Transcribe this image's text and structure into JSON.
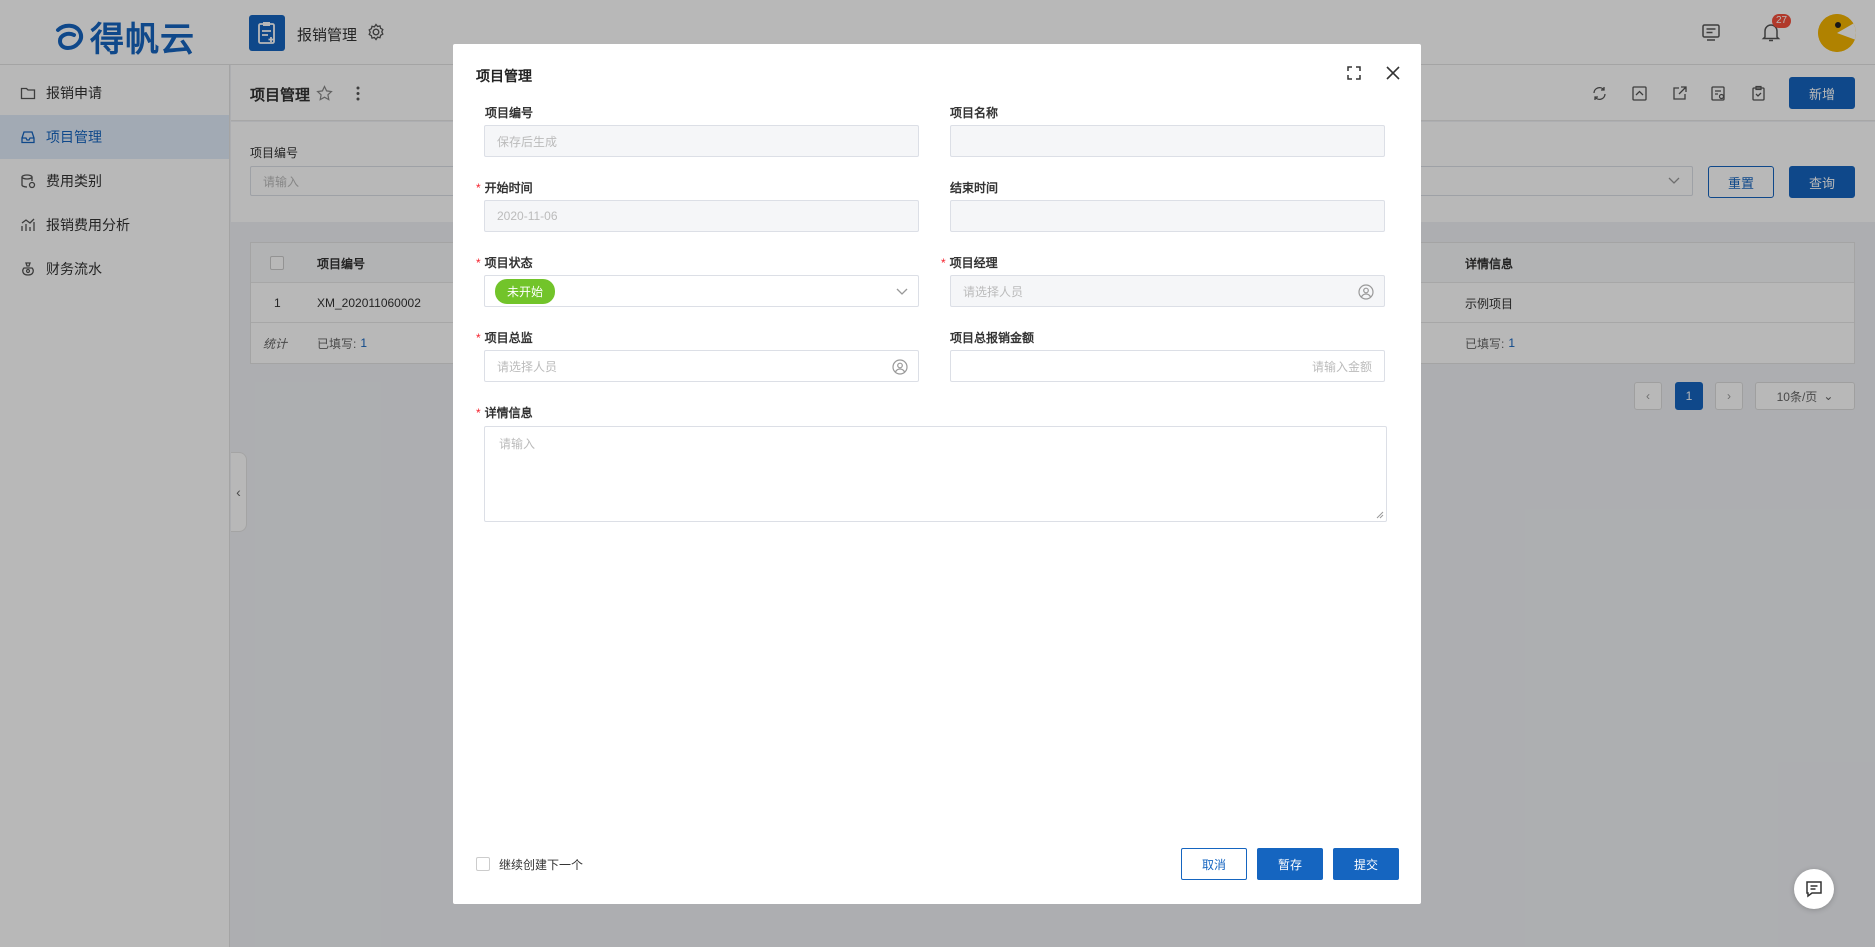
{
  "app": {
    "logo": "得帆云",
    "module_title": "报销管理"
  },
  "header": {
    "notification_count": "27"
  },
  "sidebar": {
    "items": [
      {
        "label": "报销申请",
        "icon": "folder-icon"
      },
      {
        "label": "项目管理",
        "icon": "inbox-icon",
        "active": true
      },
      {
        "label": "费用类别",
        "icon": "database-icon"
      },
      {
        "label": "报销费用分析",
        "icon": "chart-icon"
      },
      {
        "label": "财务流水",
        "icon": "money-bag-icon"
      }
    ]
  },
  "page": {
    "title": "项目管理",
    "add_label": "新增"
  },
  "filter": {
    "field_label": "项目编号",
    "field_placeholder": "请输入",
    "reset_label": "重置",
    "query_label": "查询"
  },
  "table": {
    "headers": [
      "项目编号",
      "详情信息"
    ],
    "rows": [
      {
        "index": "1",
        "code": "XM_202011060002",
        "detail": "示例项目"
      }
    ],
    "summary": {
      "label": "统计",
      "filled_label": "已填写:",
      "filled_count": "1",
      "filled_label2": "已填写:",
      "filled_count2": "1"
    }
  },
  "pagination": {
    "current": "1",
    "page_size": "10条/页"
  },
  "modal": {
    "title": "项目管理",
    "fields": {
      "code": {
        "label": "项目编号",
        "placeholder": "保存后生成"
      },
      "name": {
        "label": "项目名称",
        "value": ""
      },
      "start": {
        "label": "开始时间",
        "value": "2020-11-06",
        "required": true
      },
      "end": {
        "label": "结束时间",
        "value": ""
      },
      "status": {
        "label": "项目状态",
        "value": "未开始",
        "required": true
      },
      "manager": {
        "label": "项目经理",
        "placeholder": "请选择人员",
        "required": true
      },
      "director": {
        "label": "项目总监",
        "placeholder": "请选择人员",
        "required": true
      },
      "amount": {
        "label": "项目总报销金额",
        "placeholder": "请输入金额"
      },
      "detail": {
        "label": "详情信息",
        "placeholder": "请输入",
        "required": true
      }
    },
    "continue_label": "继续创建下一个",
    "cancel_label": "取消",
    "draft_label": "暂存",
    "submit_label": "提交"
  },
  "colors": {
    "primary": "#1565c0",
    "status_tag": "#72c42a",
    "required": "#f5222d",
    "badge": "#f5503c"
  }
}
